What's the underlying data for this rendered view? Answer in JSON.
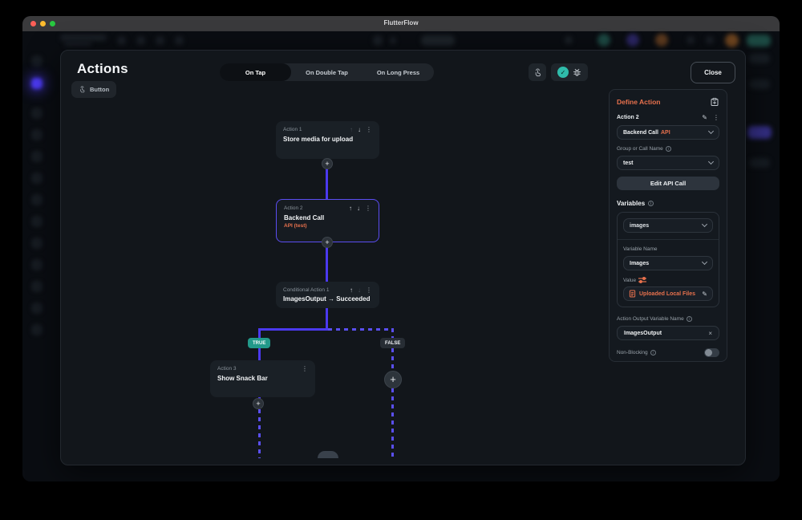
{
  "window": {
    "title": "FlutterFlow"
  },
  "modal": {
    "title": "Actions",
    "tabs": [
      {
        "label": "On Tap",
        "active": true
      },
      {
        "label": "On Double Tap",
        "active": false
      },
      {
        "label": "On Long Press",
        "active": false
      }
    ],
    "trigger_chip": "Button",
    "close_label": "Close"
  },
  "flow": {
    "nodes": [
      {
        "label": "Action 1",
        "title": "Store media for upload"
      },
      {
        "label": "Action 2",
        "title": "Backend Call",
        "subtitle": "API (test)"
      },
      {
        "label": "Conditional Action 1",
        "title": "ImagesOutput → Succeeded"
      },
      {
        "label": "Action 3",
        "title": "Show Snack Bar"
      }
    ],
    "true_label": "TRUE",
    "false_label": "FALSE"
  },
  "panel": {
    "title": "Define Action",
    "action_label": "Action 2",
    "action_type": "Backend Call",
    "action_type_tag": "API",
    "group_call_label": "Group or Call Name",
    "group_call_value": "test",
    "edit_api_button": "Edit API Call",
    "variables_title": "Variables",
    "variable_select": "images",
    "variable_name_label": "Variable Name",
    "variable_name_value": "Images",
    "value_label": "Value",
    "value_text": "Uploaded Local Files",
    "output_label": "Action Output Variable Name",
    "output_value": "ImagesOutput",
    "non_blocking_label": "Non-Blocking"
  },
  "icons": {
    "up_arrow": "↑",
    "down_arrow": "↓",
    "kebab": "⋮",
    "pencil": "✎",
    "plus": "+",
    "check": "✓",
    "clear_x": "×",
    "info": "i"
  },
  "colors": {
    "accent_orange": "#e8714d",
    "primary_purple": "#4b39ef",
    "teal_true": "#22998a",
    "teal_check": "#2fbcab"
  }
}
